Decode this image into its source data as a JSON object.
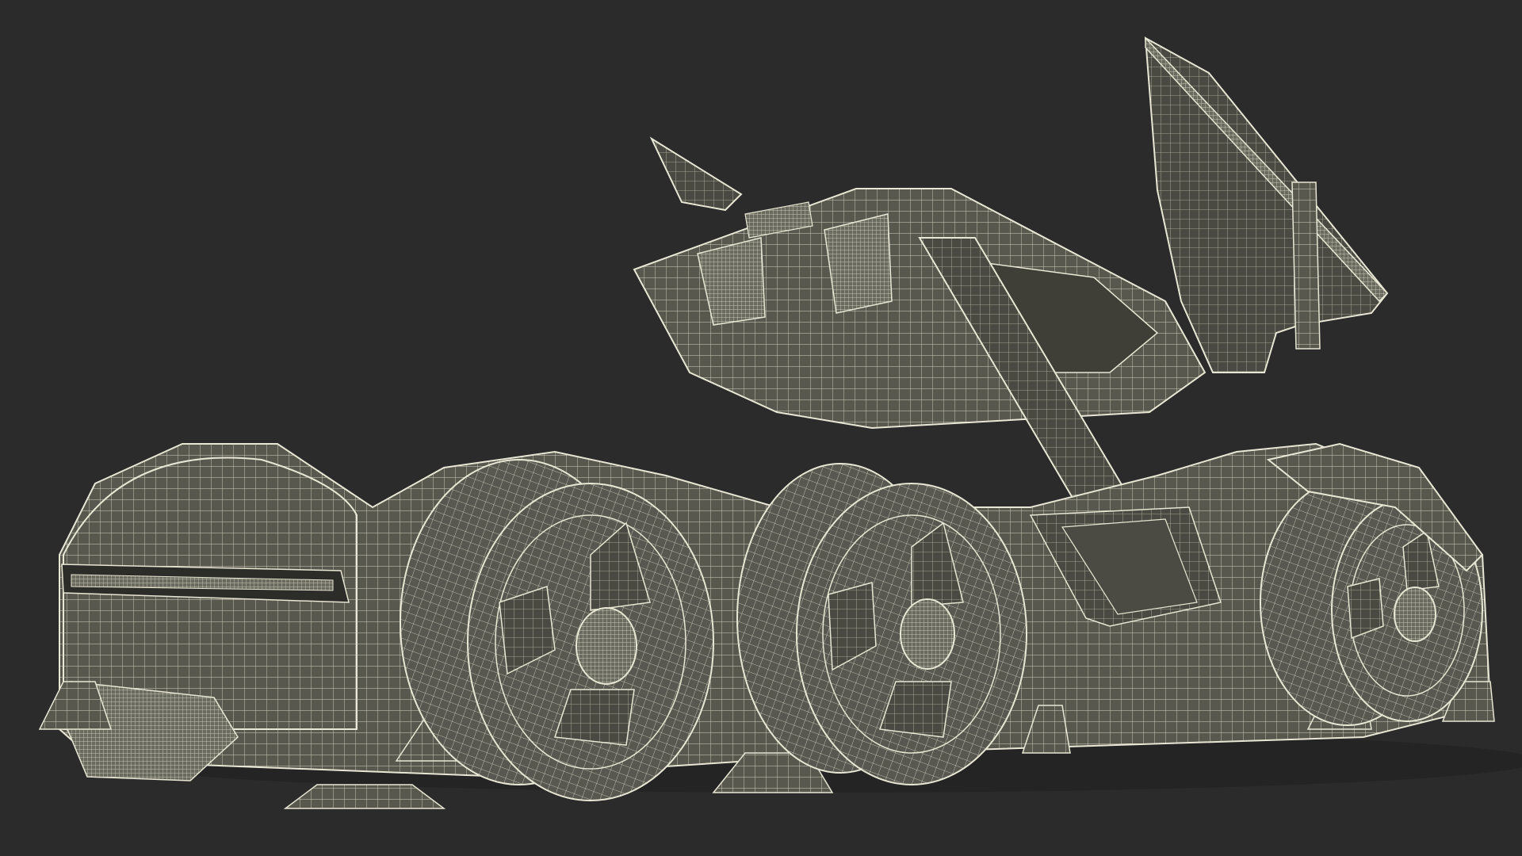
{
  "scene": {
    "subject": "wireframe-render",
    "background_color": "#2b2b2b",
    "surface_color": "#56564c",
    "wire_color": "#e8e6d4",
    "shadow_color": "#3d3d36"
  }
}
